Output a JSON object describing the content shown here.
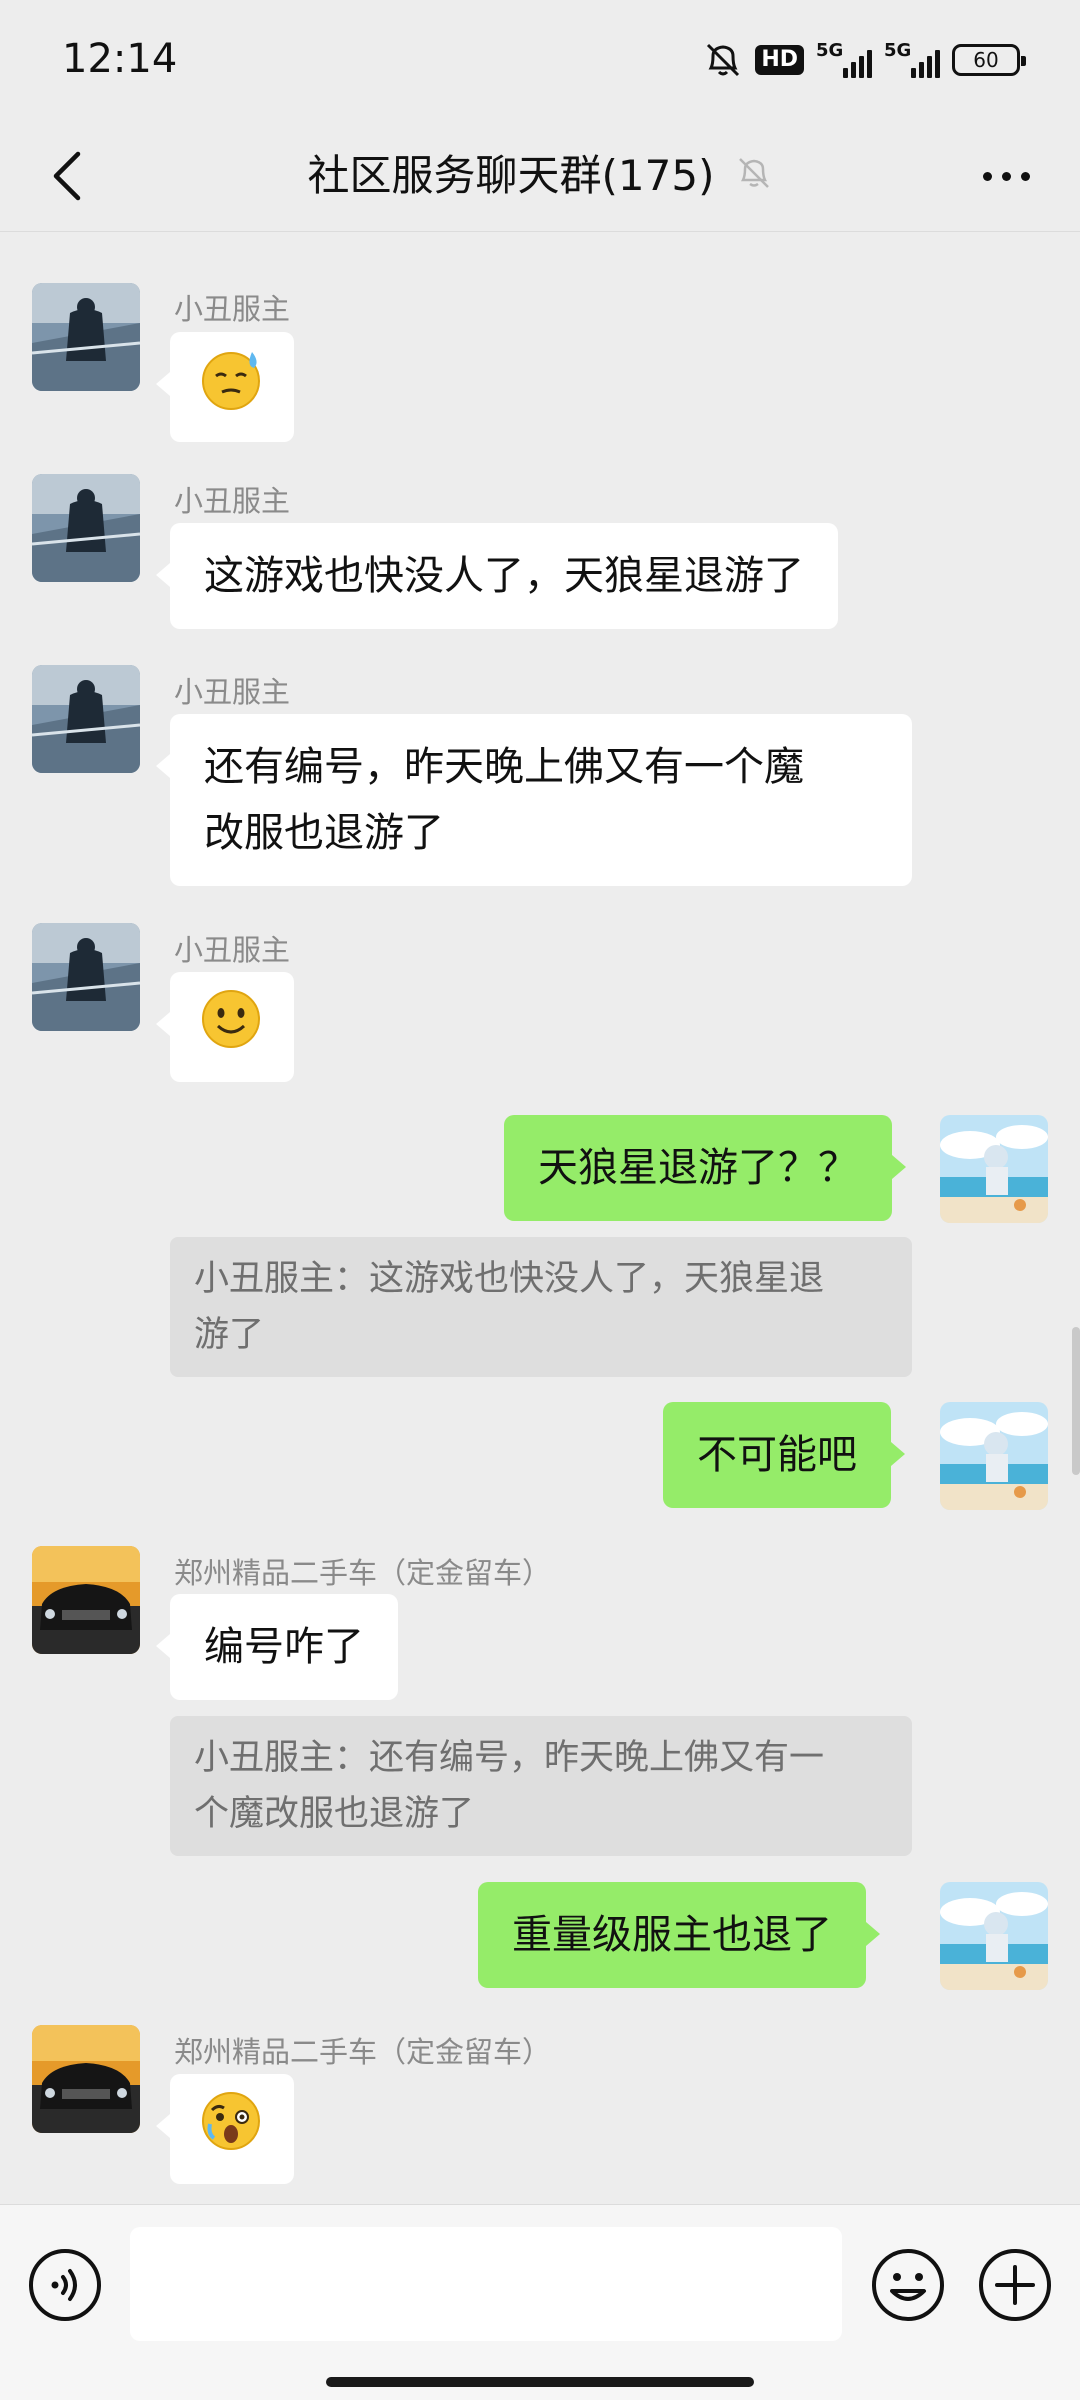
{
  "status_bar": {
    "time": "12:14",
    "hd": "HD",
    "net1": "5G",
    "net2": "5G",
    "battery": "60"
  },
  "nav": {
    "title": "社区服务聊天群(175)"
  },
  "messages": [
    {
      "sender": "小丑服主",
      "emoji": "sweat-smile-emoji"
    },
    {
      "sender": "小丑服主",
      "text": "这游戏也快没人了，天狼星退游了"
    },
    {
      "sender": "小丑服主",
      "text_line1": "还有编号，昨天晚上佛又有一个魔",
      "text_line2": "改服也退游了"
    },
    {
      "sender": "小丑服主",
      "emoji": "smile-emoji"
    },
    {
      "text": "天狼星退游了？？",
      "quote_line1": "小丑服主：这游戏也快没人了，天狼星退",
      "quote_line2": "游了"
    },
    {
      "text": "不可能吧"
    },
    {
      "sender": "郑州精品二手车（定金留车）",
      "text": "编号咋了",
      "quote_line1": "小丑服主：还有编号，昨天晚上佛又有一",
      "quote_line2": "个魔改服也退游了"
    },
    {
      "text": "重量级服主也退了"
    },
    {
      "sender": "郑州精品二手车（定金留车）",
      "emoji": "scared-emoji"
    }
  ],
  "input": {
    "placeholder": ""
  },
  "colors": {
    "background": "#ededed",
    "bubble_self": "#95ec69",
    "bubble_other": "#ffffff",
    "quote_bg": "#dedede"
  }
}
